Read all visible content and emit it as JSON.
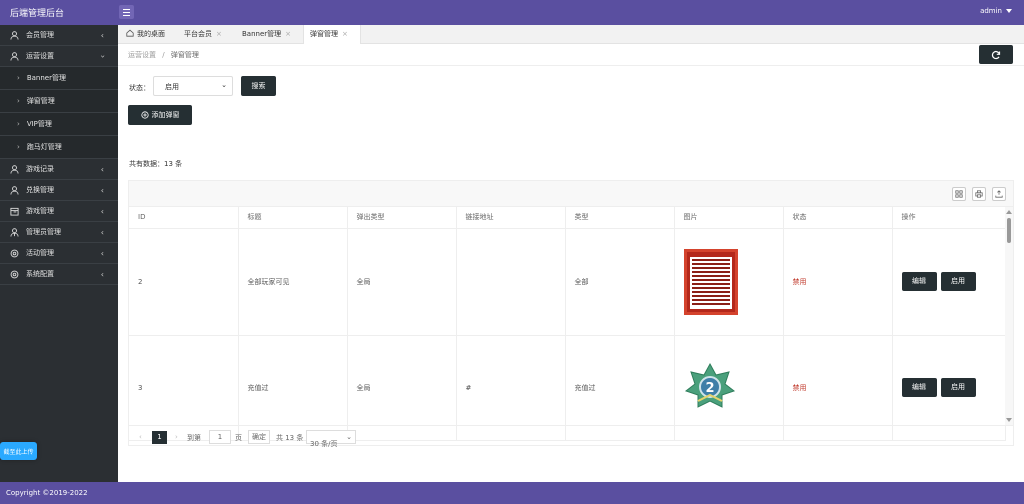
{
  "app": {
    "title": "后端管理后台",
    "user": "admin",
    "footer": "Copyright ©2019-2022"
  },
  "sidebar": {
    "items": [
      {
        "label": "会员管理",
        "icon": "user-icon"
      },
      {
        "label": "运营设置",
        "icon": "user-icon",
        "expanded": true
      },
      {
        "label": "游戏记录",
        "icon": "user-icon"
      },
      {
        "label": "兑换管理",
        "icon": "user-icon"
      },
      {
        "label": "游戏管理",
        "icon": "calendar-icon"
      },
      {
        "label": "管理员管理",
        "icon": "admin-icon"
      },
      {
        "label": "活动管理",
        "icon": "settings-icon"
      },
      {
        "label": "系统配置",
        "icon": "settings-icon"
      }
    ],
    "subitems": [
      "Banner管理",
      "弹窗管理",
      "VIP管理",
      "跑马灯管理"
    ],
    "feedback": "截至此上传"
  },
  "tabs": [
    {
      "label": "我的桌面",
      "closable": false
    },
    {
      "label": "平台会员",
      "closable": true
    },
    {
      "label": "Banner管理",
      "closable": true
    },
    {
      "label": "弹窗管理",
      "closable": true,
      "active": true
    }
  ],
  "breadcrumb": {
    "parent": "运营设置",
    "sep": "/",
    "current": "弹窗管理"
  },
  "filter": {
    "status_label": "状态：",
    "status_value": "启用",
    "search_label": "搜索"
  },
  "add_label": "添加弹窗",
  "count_text": "共有数据：13 条",
  "table": {
    "columns": [
      "ID",
      "标题",
      "弹出类型",
      "链接地址",
      "类型",
      "图片",
      "状态",
      "操作"
    ],
    "rows": [
      {
        "id": "2",
        "title": "全部玩家可见",
        "popup_type": "全局",
        "link": "",
        "type": "全部",
        "image": "promo-poster",
        "status": "禁用",
        "edit": "编辑",
        "enable": "启用"
      },
      {
        "id": "3",
        "title": "充值过",
        "popup_type": "全局",
        "link": "#",
        "type": "充值过",
        "image": "vip-badge",
        "status": "禁用",
        "edit": "编辑",
        "enable": "启用"
      }
    ]
  },
  "pager": {
    "current": "1",
    "goto_label": "到第",
    "goto_value": "1",
    "page_unit": "页",
    "confirm": "确定",
    "total": "共 13 条",
    "per_page": "30 条/页"
  },
  "colors": {
    "header": "#5a4fa0",
    "sidebar": "#2b2f33",
    "button": "#252f33",
    "danger": "#c0392b"
  }
}
